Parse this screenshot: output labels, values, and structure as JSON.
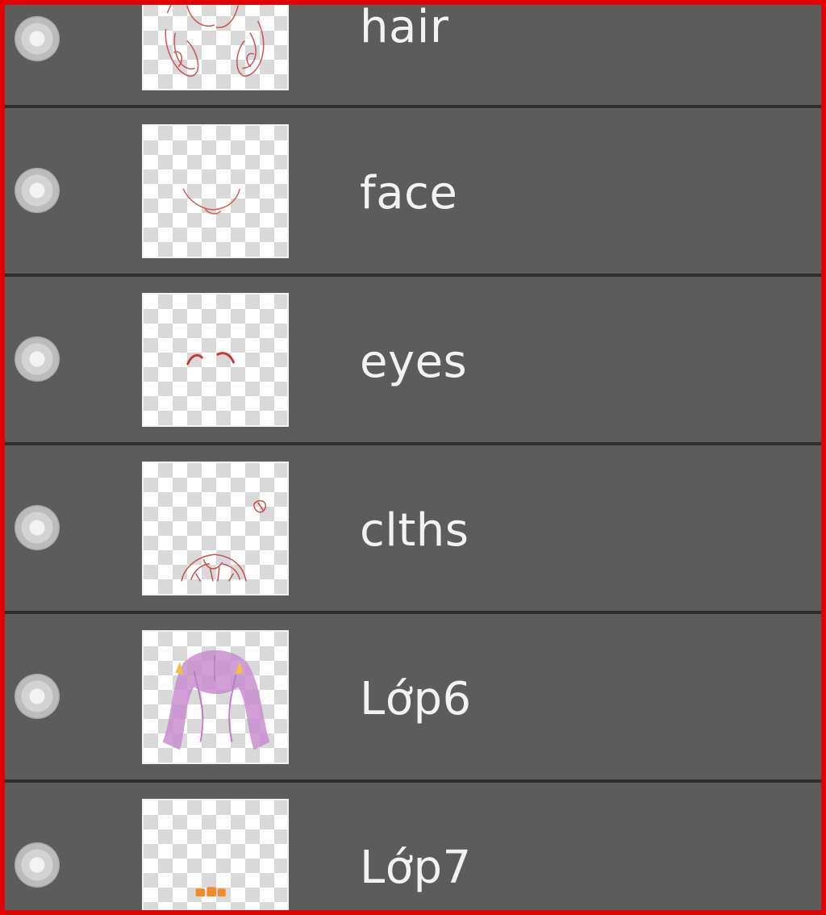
{
  "layers_panel": {
    "layers": [
      {
        "name": "hair",
        "thumbnail_icon": "hair-sketch-thumbnail"
      },
      {
        "name": "face",
        "thumbnail_icon": "face-sketch-thumbnail"
      },
      {
        "name": "eyes",
        "thumbnail_icon": "eyes-sketch-thumbnail"
      },
      {
        "name": "clths",
        "thumbnail_icon": "clothes-sketch-thumbnail"
      },
      {
        "name": "Lớp6",
        "thumbnail_icon": "purple-hair-color-thumbnail"
      },
      {
        "name": "Lớp7",
        "thumbnail_icon": "orange-accent-thumbnail"
      }
    ],
    "colors": {
      "background": "#5c5c5c",
      "separator": "#2f2f2f",
      "highlight_border": "#e30000",
      "text": "#f2f2f2",
      "sketch_red": "#c94a4a",
      "purple_fill": "#c98fd0",
      "orange_accent": "#f08a2a"
    }
  }
}
